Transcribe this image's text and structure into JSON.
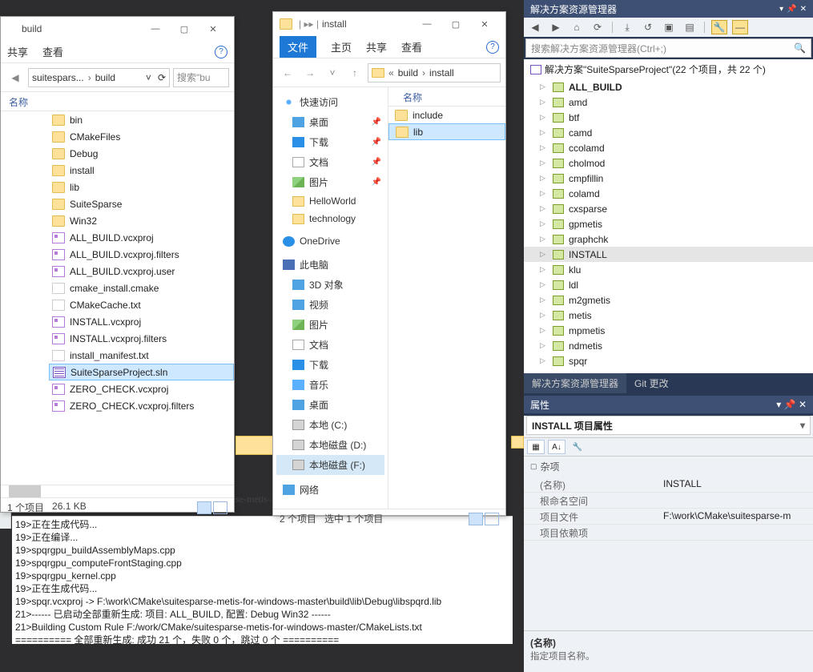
{
  "explorer_left": {
    "title": "build",
    "ribbon": {
      "share": "共享",
      "view": "查看"
    },
    "breadcrumb": [
      "suitespars...",
      "build"
    ],
    "search_placeholder": "搜索\"bu",
    "column": "名称",
    "files": [
      {
        "icon": "folder",
        "name": "bin"
      },
      {
        "icon": "folder",
        "name": "CMakeFiles"
      },
      {
        "icon": "folder",
        "name": "Debug"
      },
      {
        "icon": "folder",
        "name": "install"
      },
      {
        "icon": "folder",
        "name": "lib"
      },
      {
        "icon": "folder",
        "name": "SuiteSparse"
      },
      {
        "icon": "folder",
        "name": "Win32"
      },
      {
        "icon": "vcx",
        "name": "ALL_BUILD.vcxproj"
      },
      {
        "icon": "vcx",
        "name": "ALL_BUILD.vcxproj.filters"
      },
      {
        "icon": "vcx",
        "name": "ALL_BUILD.vcxproj.user"
      },
      {
        "icon": "txt",
        "name": "cmake_install.cmake"
      },
      {
        "icon": "txt",
        "name": "CMakeCache.txt"
      },
      {
        "icon": "vcx",
        "name": "INSTALL.vcxproj"
      },
      {
        "icon": "vcx",
        "name": "INSTALL.vcxproj.filters"
      },
      {
        "icon": "txt",
        "name": "install_manifest.txt"
      },
      {
        "icon": "sln",
        "name": "SuiteSparseProject.sln",
        "selected": true
      },
      {
        "icon": "vcx",
        "name": "ZERO_CHECK.vcxproj"
      },
      {
        "icon": "vcx",
        "name": "ZERO_CHECK.vcxproj.filters"
      }
    ],
    "status_left": "1 个项目",
    "status_size": "26.1 KB"
  },
  "explorer_mid": {
    "title": "install",
    "ribbon": {
      "file": "文件",
      "home": "主页",
      "share": "共享",
      "view": "查看"
    },
    "breadcrumb": [
      "build",
      "install"
    ],
    "column": "名称",
    "quick_access": "快速访问",
    "nav": {
      "desktop": "桌面",
      "downloads": "下载",
      "documents": "文档",
      "pictures": "图片",
      "hw": "HelloWorld",
      "tech": "technology",
      "onedrive": "OneDrive",
      "thispc": "此电脑",
      "threed": "3D 对象",
      "videos": "视频",
      "pictures2": "图片",
      "documents2": "文档",
      "downloads2": "下载",
      "music": "音乐",
      "desktop2": "桌面",
      "localc": "本地 (C:)",
      "locald": "本地磁盘 (D:)",
      "localf": "本地磁盘 (F:)",
      "network": "网络"
    },
    "files": [
      {
        "icon": "folder",
        "name": "include"
      },
      {
        "icon": "folder",
        "name": "lib",
        "selected": true
      }
    ],
    "status_left": "2 个项目",
    "status_sel": "选中 1 个项目"
  },
  "output_lines": [
    "19>正在生成代码...",
    "19>正在编译...",
    "19>spqrgpu_buildAssemblyMaps.cpp",
    "19>spqrgpu_computeFrontStaging.cpp",
    "19>spqrgpu_kernel.cpp",
    "19>正在生成代码...",
    "19>spqr.vcxproj -> F:\\work\\CMake\\suitesparse-metis-for-windows-master\\build\\lib\\Debug\\libspqrd.lib",
    "21>------ 已启动全部重新生成: 项目: ALL_BUILD, 配置: Debug Win32 ------",
    "21>Building Custom Rule F:/work/CMake/suitesparse-metis-for-windows-master/CMakeLists.txt",
    "========== 全部重新生成: 成功 21 个，失败 0 个，跳过 0 个 =========="
  ],
  "behind_text": "se-metis-",
  "sln_explorer": {
    "title": "解决方案资源管理器",
    "search_placeholder": "搜索解决方案资源管理器(Ctrl+;)",
    "root": "解决方案\"SuiteSparseProject\"(22 个项目，共 22 个)",
    "projects": [
      {
        "name": "ALL_BUILD",
        "bold": true
      },
      {
        "name": "amd"
      },
      {
        "name": "btf"
      },
      {
        "name": "camd"
      },
      {
        "name": "ccolamd"
      },
      {
        "name": "cholmod"
      },
      {
        "name": "cmpfillin"
      },
      {
        "name": "colamd"
      },
      {
        "name": "cxsparse"
      },
      {
        "name": "gpmetis"
      },
      {
        "name": "graphchk"
      },
      {
        "name": "INSTALL",
        "selected": true
      },
      {
        "name": "klu"
      },
      {
        "name": "ldl"
      },
      {
        "name": "m2gmetis"
      },
      {
        "name": "metis"
      },
      {
        "name": "mpmetis"
      },
      {
        "name": "ndmetis"
      },
      {
        "name": "spqr"
      }
    ],
    "tabs": {
      "sln": "解决方案资源管理器",
      "git": "Git 更改"
    }
  },
  "props": {
    "title": "属性",
    "header": "INSTALL 项目属性",
    "category": "杂项",
    "rows": [
      {
        "k": "(名称)",
        "v": "INSTALL"
      },
      {
        "k": "根命名空间",
        "v": ""
      },
      {
        "k": "项目文件",
        "v": "F:\\work\\CMake\\suitesparse-m"
      },
      {
        "k": "项目依赖项",
        "v": ""
      }
    ],
    "desc_title": "(名称)",
    "desc_text": "指定项目名称。"
  }
}
